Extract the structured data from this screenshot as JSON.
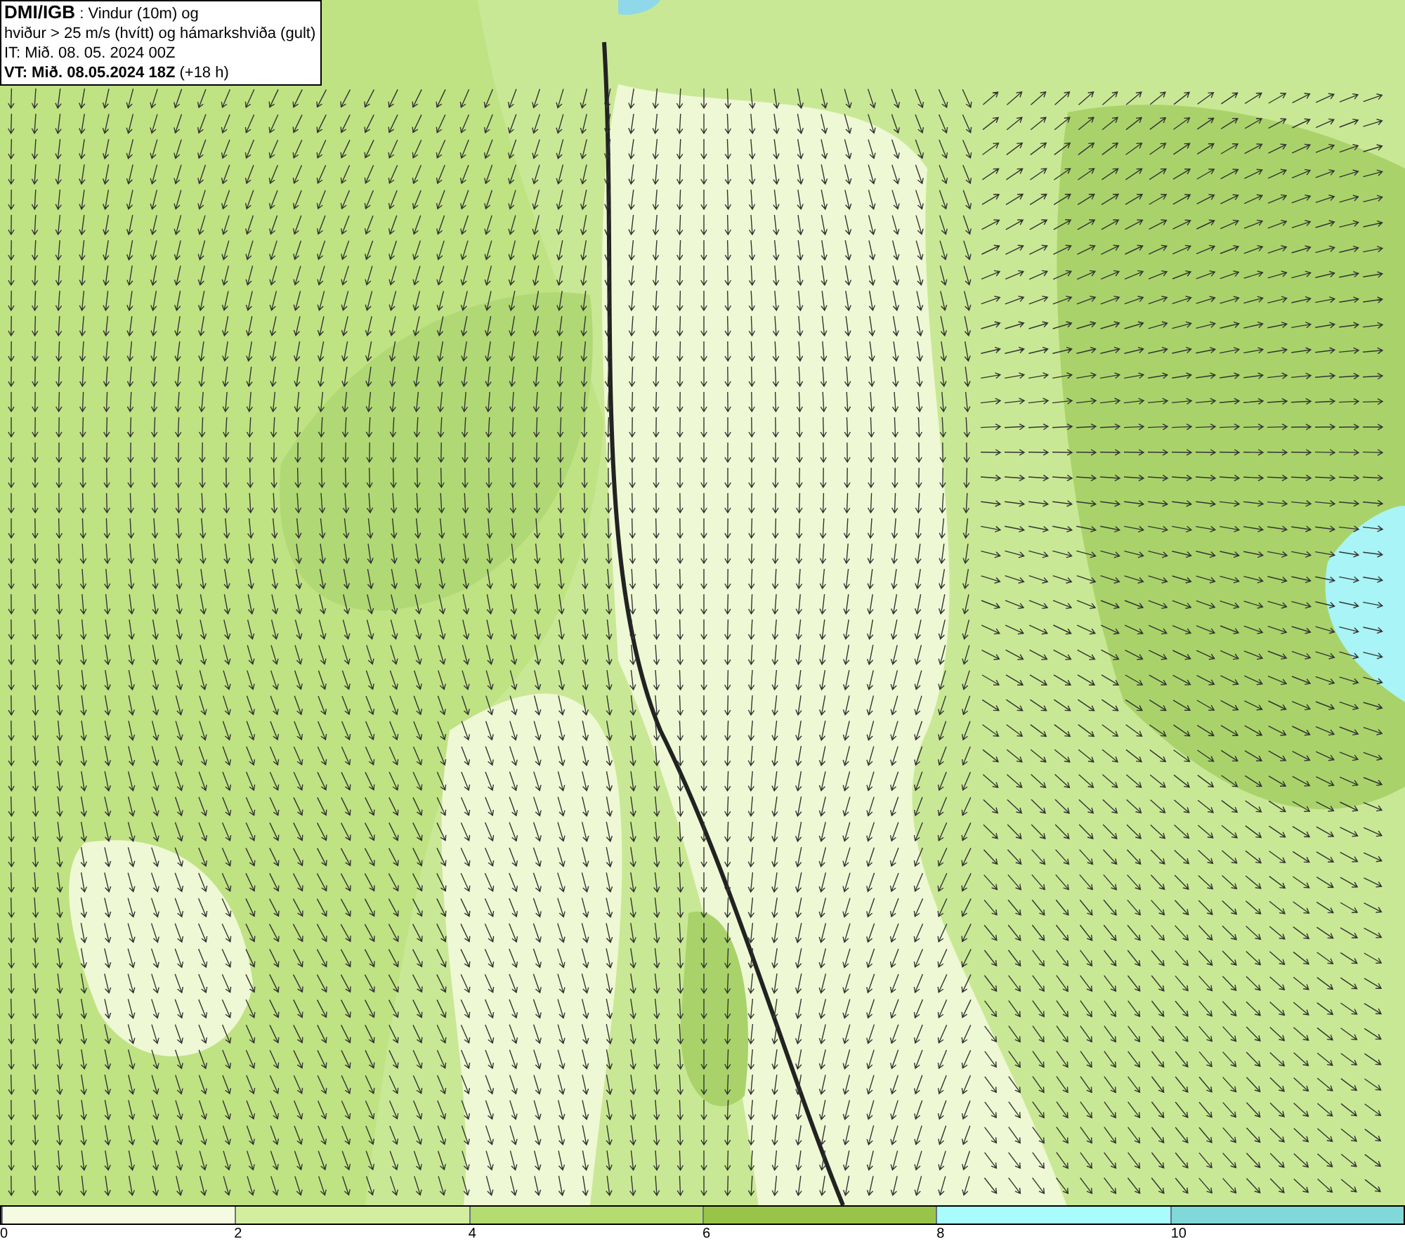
{
  "title_box": {
    "lines": [
      "**DMI/IGB** : Vindur (10m) og",
      "hviður > 25 m/s (hvítt) og hámarkshviða (gult)",
      "IT: Mið. 08. 05. 2024 00Z",
      "**VT: Mið. 08.05.2024 18Z** (+18 h)"
    ]
  },
  "legend": {
    "segments": [
      {
        "color": "#f5fbe0"
      },
      {
        "color": "#d4eea0"
      },
      {
        "color": "#b5dc70"
      },
      {
        "color": "#98c44a"
      },
      {
        "color": "#a8fcfc"
      },
      {
        "color": "#80d8d8"
      }
    ],
    "ticks": [
      "0",
      "2",
      "4",
      "6",
      "8",
      "10"
    ]
  }
}
